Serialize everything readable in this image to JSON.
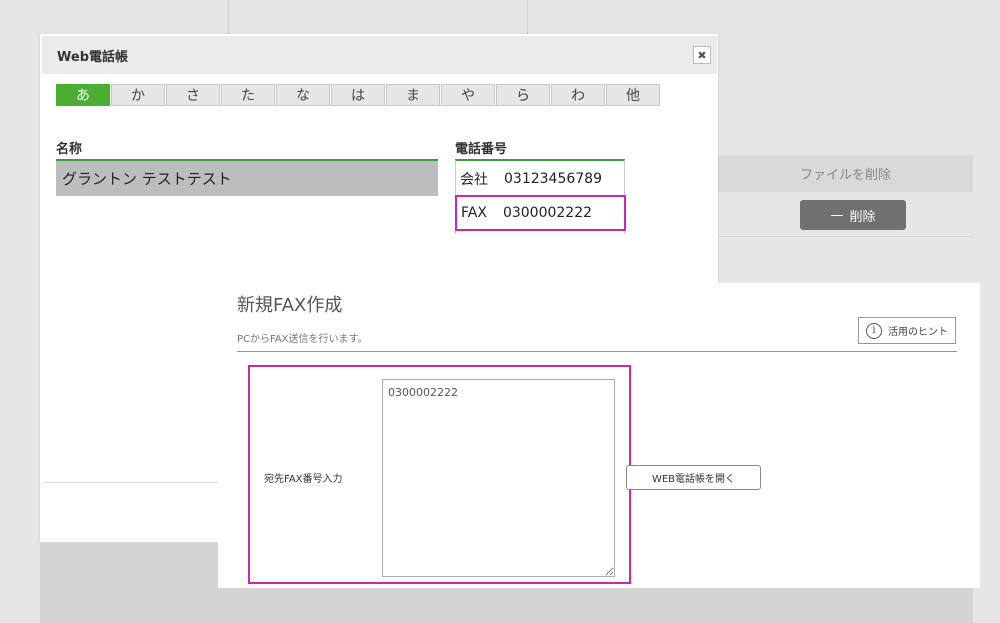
{
  "background": {
    "file_delete_label": "ファイルを削除",
    "delete_button_label": "削除",
    "delete_button_dash": "—"
  },
  "phonebook": {
    "title": "Web電話帳",
    "close_glyph": "✖",
    "kana_tabs": [
      "あ",
      "か",
      "さ",
      "た",
      "な",
      "は",
      "ま",
      "や",
      "ら",
      "わ",
      "他"
    ],
    "active_tab": "あ",
    "columns": {
      "name": "名称",
      "phone": "電話番号"
    },
    "entry": {
      "name": "グラントン テストテスト",
      "phones": [
        {
          "type": "会社",
          "number": "03123456789"
        },
        {
          "type": "FAX",
          "number": "0300002222"
        }
      ]
    }
  },
  "fax": {
    "title": "新規FAX作成",
    "description": "PCからFAX送信を行います。",
    "hint_button": "活用のヒント",
    "hint_icon_glyph": "i",
    "input_label": "宛先FAX番号入力",
    "input_value": "0300002222",
    "open_phonebook_button": "WEB電話帳を開く"
  },
  "colors": {
    "active_tab": "#4cad33",
    "highlight": "#c42ab0",
    "header_rule": "#3e9a3e"
  }
}
